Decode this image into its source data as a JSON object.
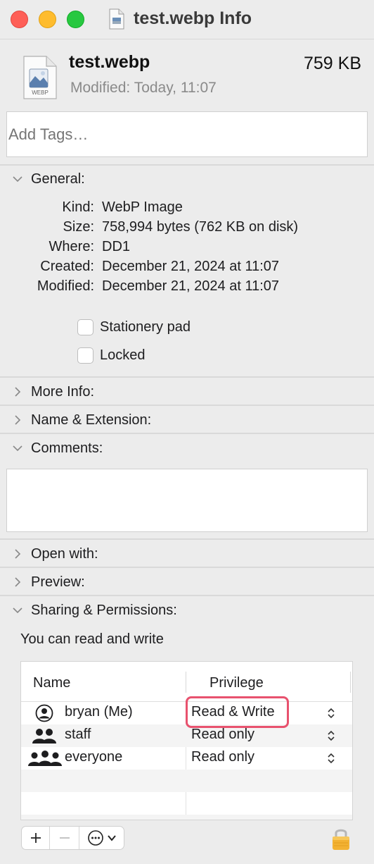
{
  "window": {
    "title": "test.webp Info"
  },
  "header": {
    "file_name": "test.webp",
    "file_size": "759 KB",
    "modified_label": "Modified:",
    "modified_value": "Today, 11:07",
    "icon_badge": "WEBP"
  },
  "tags": {
    "placeholder": "Add Tags…"
  },
  "sections": {
    "general": "General:",
    "more_info": "More Info:",
    "name_ext": "Name & Extension:",
    "comments": "Comments:",
    "open_with": "Open with:",
    "preview": "Preview:",
    "sharing": "Sharing & Permissions:"
  },
  "general": {
    "rows": [
      {
        "label": "Kind:",
        "value": "WebP Image"
      },
      {
        "label": "Size:",
        "value": "758,994 bytes (762 KB on disk)"
      },
      {
        "label": "Where:",
        "value": "DD1"
      },
      {
        "label": "Created:",
        "value": "December 21, 2024 at 11:07"
      },
      {
        "label": "Modified:",
        "value": "December 21, 2024 at 11:07"
      }
    ],
    "stationery_label": "Stationery pad",
    "stationery_checked": false,
    "locked_label": "Locked",
    "locked_checked": false
  },
  "permissions": {
    "summary": "You can read and write",
    "col_name": "Name",
    "col_privilege": "Privilege",
    "rows": [
      {
        "name": "bryan (Me)",
        "privilege": "Read & Write",
        "icon": "person-icon"
      },
      {
        "name": "staff",
        "privilege": "Read only",
        "icon": "group-icon"
      },
      {
        "name": "everyone",
        "privilege": "Read only",
        "icon": "everyone-icon"
      }
    ]
  },
  "toolbar": {
    "add": "+",
    "remove": "−"
  },
  "colors": {
    "highlight": "#e8526e",
    "close": "#fe5f57",
    "minimize": "#febc2e",
    "zoom": "#28c840"
  }
}
